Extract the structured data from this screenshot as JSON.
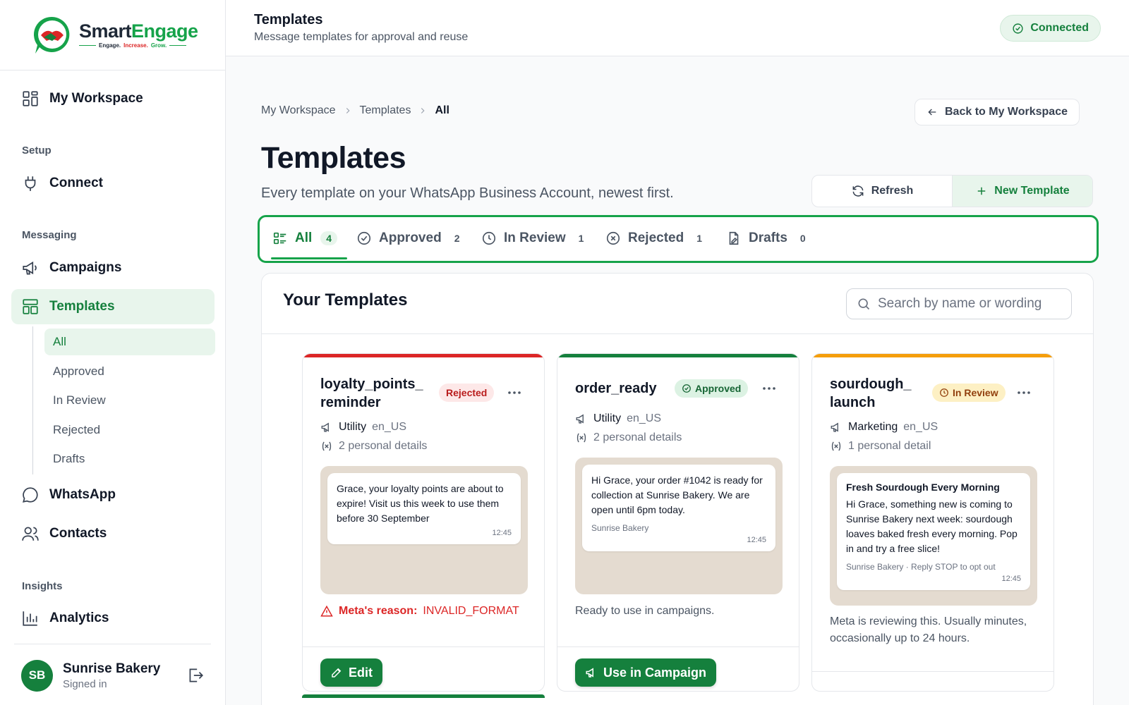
{
  "brand": {
    "name_part1": "Smart",
    "name_part2": "Engage",
    "tag_1": "Engage.",
    "tag_2": "Increase.",
    "tag_3": "Grow.",
    "colors": {
      "primary": "#15803d",
      "accent_red": "#dc2626"
    }
  },
  "sidebar": {
    "workspace": "My Workspace",
    "setup_label": "Setup",
    "connect": "Connect",
    "messaging_label": "Messaging",
    "campaigns": "Campaigns",
    "templates": "Templates",
    "templates_sub": [
      "All",
      "Approved",
      "In Review",
      "Rejected",
      "Drafts"
    ],
    "whatsapp": "WhatsApp",
    "contacts": "Contacts",
    "insights_label": "Insights",
    "analytics": "Analytics",
    "user": {
      "initials": "SB",
      "name": "Sunrise Bakery",
      "status": "Signed in"
    }
  },
  "header": {
    "title": "Templates",
    "subtitle": "Message templates for approval and reuse",
    "connection": "Connected"
  },
  "breadcrumb": [
    "My Workspace",
    "Templates",
    "All"
  ],
  "back_button": "Back to My Workspace",
  "page": {
    "title": "Templates",
    "description": "Every template on your WhatsApp Business Account, newest first."
  },
  "actions": {
    "refresh": "Refresh",
    "new_template": "New Template"
  },
  "tabs": [
    {
      "label": "All",
      "count": "4"
    },
    {
      "label": "Approved",
      "count": "2"
    },
    {
      "label": "In Review",
      "count": "1"
    },
    {
      "label": "Rejected",
      "count": "1"
    },
    {
      "label": "Drafts",
      "count": "0"
    }
  ],
  "panel": {
    "title": "Your Templates",
    "search_placeholder": "Search by name or wording"
  },
  "cards": [
    {
      "name_line1": "loyalty_points_",
      "name_line2": "reminder",
      "status": "Rejected",
      "status_color": "#dc2626",
      "category": "Utility",
      "language": "en_US",
      "variables": "2 personal details",
      "body": "Grace, your loyalty points are about to expire! Visit us this week to use them before 30 September",
      "time": "12:45",
      "reason_label": "Meta's reason:",
      "reason_code": "INVALID_FORMAT",
      "button": "Edit"
    },
    {
      "name": "order_ready",
      "status": "Approved",
      "status_color": "#15803d",
      "category": "Utility",
      "language": "en_US",
      "variables": "2 personal details",
      "body": "Hi Grace, your order #1042 is ready for collection at Sunrise Bakery. We are open until 6pm today.",
      "footer": "Sunrise Bakery",
      "time": "12:45",
      "note": "Ready to use in campaigns.",
      "button": "Use in Campaign"
    },
    {
      "name_line1": "sourdough_",
      "name_line2": "launch",
      "status": "In Review",
      "status_color": "#f59e0b",
      "category": "Marketing",
      "language": "en_US",
      "variables": "1 personal detail",
      "header": "Fresh Sourdough Every Morning",
      "body": "Hi Grace, something new is coming to Sunrise Bakery next week: sourdough loaves baked fresh every morning. Pop in and try a free slice!",
      "footer": "Sunrise Bakery · Reply STOP to opt out",
      "time": "12:45",
      "note": "Meta is reviewing this. Usually minutes, occasionally up to 24 hours."
    }
  ]
}
